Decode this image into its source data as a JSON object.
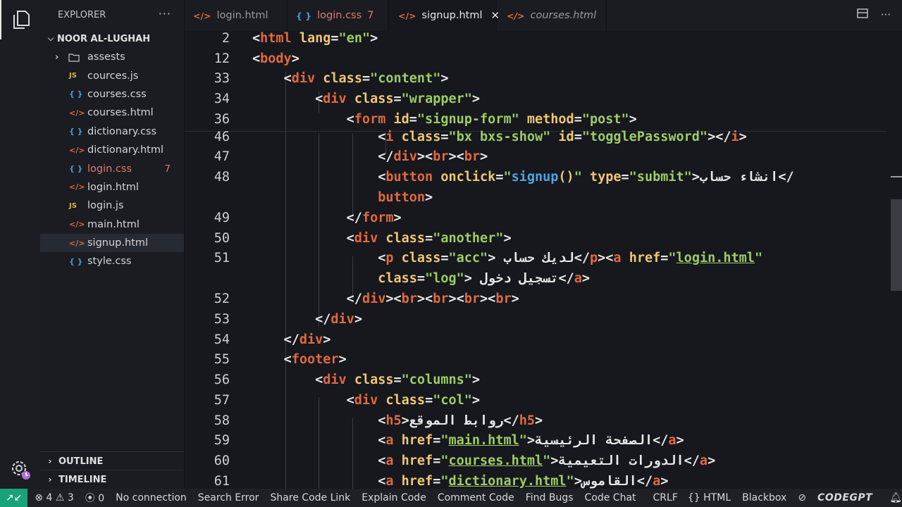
{
  "explorer": {
    "title": "EXPLORER",
    "more": "···",
    "project": "NOOR AL-LUGHAH"
  },
  "files": [
    {
      "name": "assests",
      "icon": "folder",
      "kind": "folder"
    },
    {
      "name": "cources.js",
      "icon": "JS",
      "kind": "js"
    },
    {
      "name": "courses.css",
      "icon": "{ }",
      "kind": "css"
    },
    {
      "name": "courses.html",
      "icon": "</>",
      "kind": "html"
    },
    {
      "name": "dictionary.css",
      "icon": "{ }",
      "kind": "css"
    },
    {
      "name": "dictionary.html",
      "icon": "</>",
      "kind": "html"
    },
    {
      "name": "login.css",
      "icon": "{ }",
      "kind": "css",
      "badge": "7"
    },
    {
      "name": "login.html",
      "icon": "</>",
      "kind": "html"
    },
    {
      "name": "login.js",
      "icon": "JS",
      "kind": "js"
    },
    {
      "name": "main.html",
      "icon": "</>",
      "kind": "html"
    },
    {
      "name": "signup.html",
      "icon": "</>",
      "kind": "html",
      "selected": true
    },
    {
      "name": "style.css",
      "icon": "{ }",
      "kind": "css"
    }
  ],
  "sections": {
    "outline": "OUTLINE",
    "timeline": "TIMELINE"
  },
  "tabs": [
    {
      "label": "login.html",
      "icon": "</>"
    },
    {
      "label": "login.css",
      "icon": "{ }",
      "badge": "7"
    },
    {
      "label": "signup.html",
      "icon": "</>",
      "active": true
    },
    {
      "label": "courses.html",
      "icon": "</>"
    }
  ],
  "status": {
    "errors": "4",
    "warnings": "3",
    "ports": "0",
    "connection": "No connection",
    "search_error": "Search Error",
    "share": "Share Code Link",
    "explain": "Explain Code",
    "comment": "Comment Code",
    "bugs": "Find Bugs",
    "chat": "Code Chat",
    "eol": "CRLF",
    "lang": "HTML",
    "blackbox": "Blackbox",
    "codegpt": "CODEGPT"
  },
  "colors": {
    "tag": "#e2693f",
    "attr": "#f0c674",
    "string": "#9ccc65",
    "accent": "#1aa37a"
  }
}
